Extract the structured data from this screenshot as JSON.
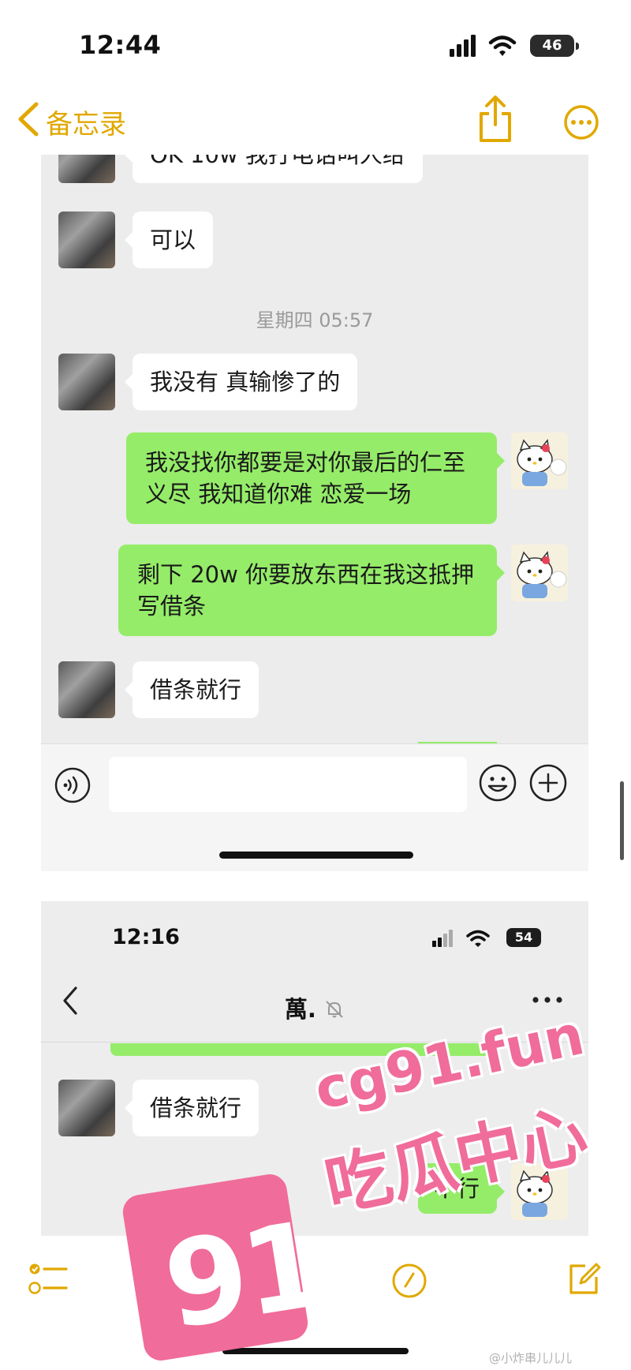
{
  "status_bar": {
    "time": "12:44",
    "battery": "46"
  },
  "notes_nav": {
    "back_label": "备忘录"
  },
  "panel1": {
    "messages": [
      {
        "side": "left",
        "text": "OK 10w 我打电话叫人给"
      },
      {
        "side": "left",
        "text": "可以"
      },
      {
        "side": "time",
        "text": "星期四 05:57"
      },
      {
        "side": "left",
        "text": "我没有 真输惨了的"
      },
      {
        "side": "right",
        "lines": [
          "我没找你都要是对你最后的仁至",
          "义尽 我知道你难 恋爱一场"
        ]
      },
      {
        "side": "right",
        "lines": [
          "剩下 20w 你要放东西在我这抵押",
          "写借条"
        ]
      },
      {
        "side": "left",
        "text": "借条就行"
      }
    ]
  },
  "panel2": {
    "status": {
      "time": "12:16",
      "battery": "54"
    },
    "chat_title": "萬.",
    "messages": [
      {
        "side": "left",
        "text": "借条就行"
      },
      {
        "side": "right",
        "text": "不行"
      }
    ]
  },
  "watermark": {
    "number": "91",
    "url": "cg91.fun",
    "name": "吃瓜中心"
  },
  "weibo_credit": "@小炸串儿儿儿"
}
